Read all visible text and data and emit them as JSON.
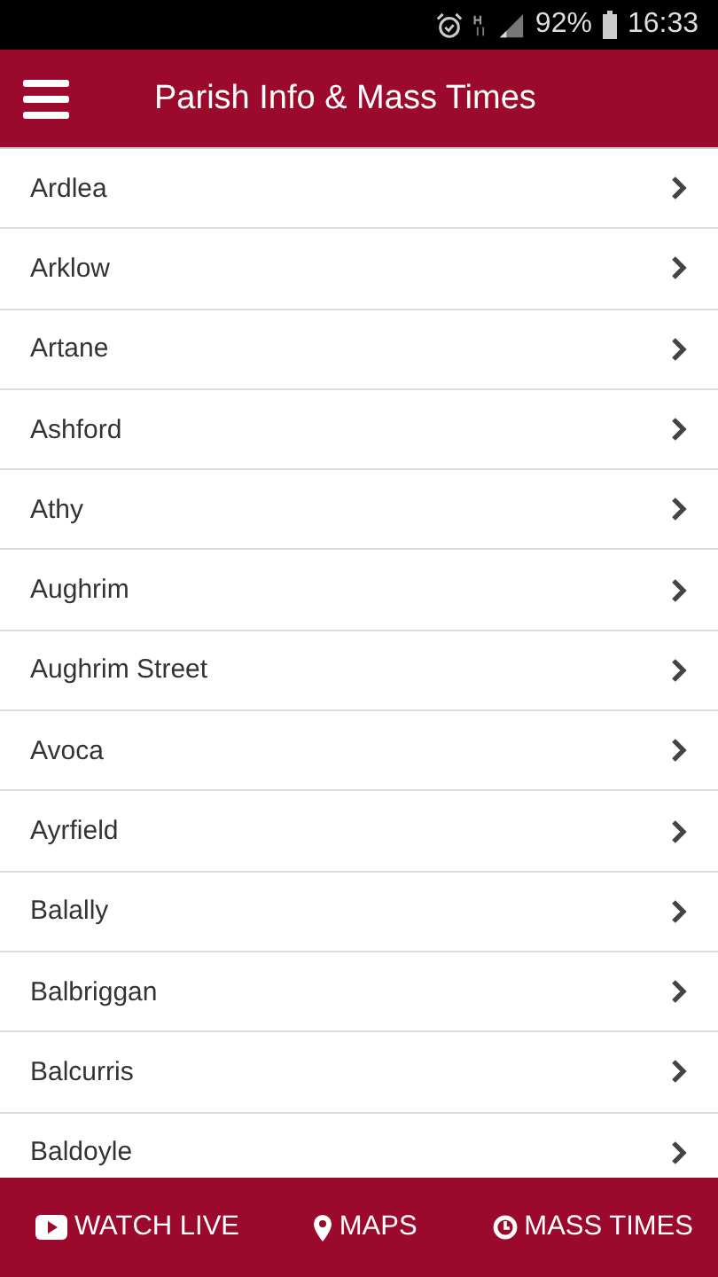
{
  "status_bar": {
    "battery": "92%",
    "time": "16:33"
  },
  "header": {
    "title": "Parish Info & Mass Times"
  },
  "parishes": [
    {
      "name": "Ardlea"
    },
    {
      "name": "Arklow"
    },
    {
      "name": "Artane"
    },
    {
      "name": "Ashford"
    },
    {
      "name": "Athy"
    },
    {
      "name": "Aughrim"
    },
    {
      "name": "Aughrim Street"
    },
    {
      "name": "Avoca"
    },
    {
      "name": "Ayrfield"
    },
    {
      "name": "Balally"
    },
    {
      "name": "Balbriggan"
    },
    {
      "name": "Balcurris"
    },
    {
      "name": "Baldoyle"
    }
  ],
  "bottom_nav": [
    {
      "kind": "video",
      "label": "WATCH LIVE"
    },
    {
      "kind": "pin",
      "label": "MAPS"
    },
    {
      "kind": "clock",
      "label": "MASS TIMES"
    }
  ]
}
